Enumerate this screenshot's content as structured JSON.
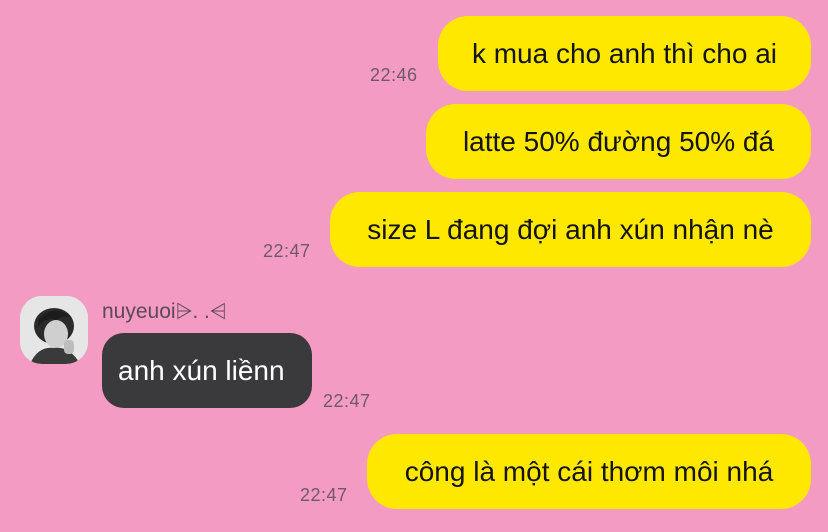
{
  "messages": [
    {
      "text": "k mua cho anh thì cho ai",
      "time": "22:46",
      "direction": "outgoing"
    },
    {
      "text": "latte 50% đường 50% đá",
      "direction": "outgoing"
    },
    {
      "text": "size L đang đợi anh xún nhận nè",
      "time": "22:47",
      "direction": "outgoing"
    },
    {
      "sender": "nuyeuoi⩥. .⩤",
      "text": "anh xún liềnn",
      "time": "22:47",
      "direction": "incoming",
      "avatar_icon": "user-avatar-photo"
    },
    {
      "text": "công là một cái thơm môi nhá",
      "time": "22:47",
      "direction": "outgoing"
    }
  ],
  "colors": {
    "background": "#f49bc3",
    "outgoing_bubble": "#ffe800",
    "incoming_bubble": "#3a3a3c",
    "timestamp": "#6e5a65"
  }
}
